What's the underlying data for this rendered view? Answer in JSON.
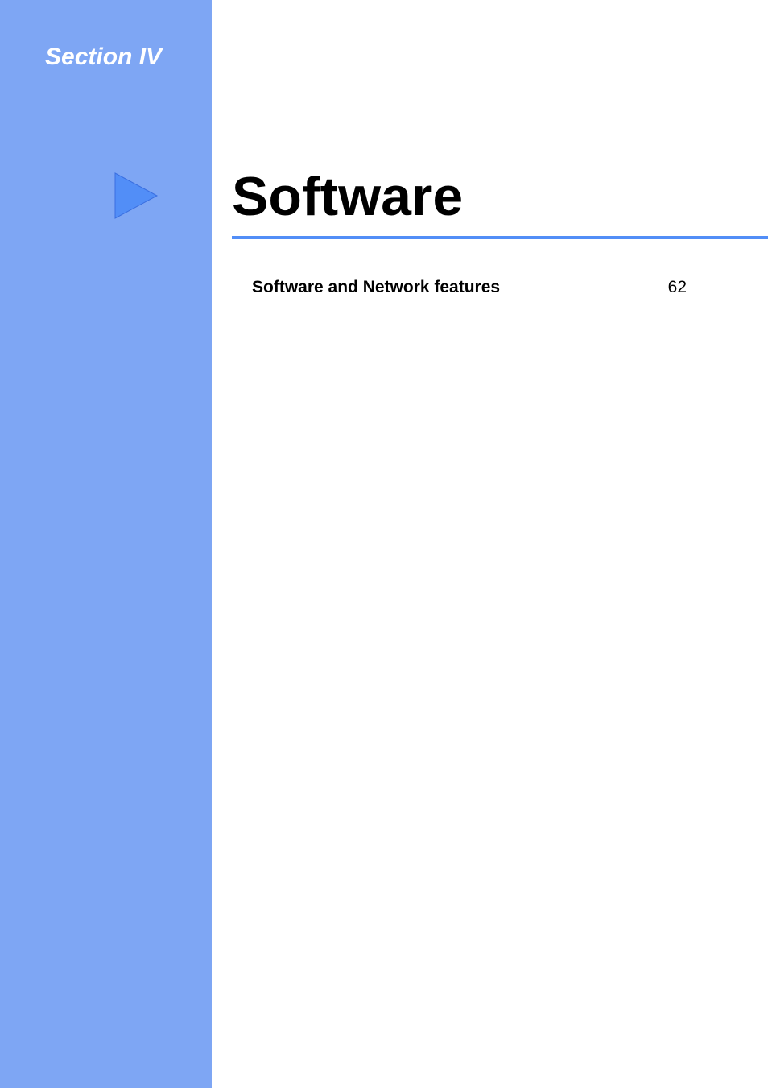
{
  "section": {
    "label": "Section IV"
  },
  "main": {
    "title": "Software"
  },
  "toc": {
    "items": [
      {
        "title": "Software and Network features",
        "page": "62"
      }
    ]
  }
}
